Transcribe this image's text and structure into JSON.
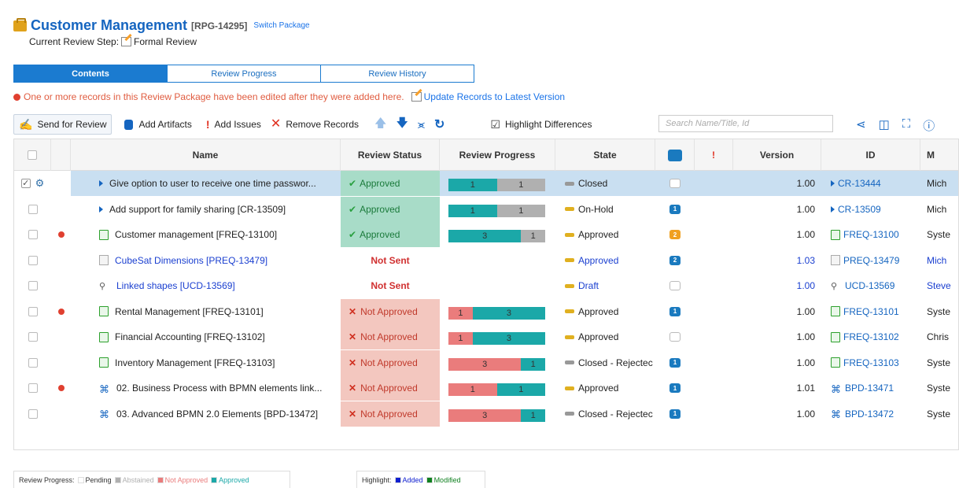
{
  "header": {
    "title": "Customer Management",
    "package_id": "[RPG-14295]",
    "switch_label": "Switch Package",
    "step_label": "Current Review Step:",
    "step_value": "Formal Review"
  },
  "tabs": [
    {
      "label": "Contents",
      "active": true
    },
    {
      "label": "Review Progress",
      "active": false
    },
    {
      "label": "Review History",
      "active": false
    }
  ],
  "warning": {
    "text": "One or more records in this Review Package have been edited after they were added here.",
    "link": "Update Records to Latest Version"
  },
  "toolbar": {
    "send": "Send for Review",
    "add_artifacts": "Add Artifacts",
    "add_issues": "Add Issues",
    "remove": "Remove Records",
    "highlight": "Highlight Differences",
    "search_placeholder": "Search Name/Title, Id"
  },
  "columns": {
    "name": "Name",
    "review_status": "Review Status",
    "review_progress": "Review Progress",
    "state": "State",
    "version": "Version",
    "id": "ID",
    "m": "M"
  },
  "rows": [
    {
      "name": "Give option to user to receive one time passwor...",
      "type": "cr",
      "status": "Approved",
      "st": "approved",
      "progress": [
        1,
        1
      ],
      "pkind": "approved-abstained",
      "state": "Closed",
      "state_color": "#999999",
      "comments": "",
      "comment_color": "",
      "version": "1.00",
      "id": "CR-13444",
      "owner": "Mich",
      "edited": false,
      "added": false,
      "selected": true
    },
    {
      "name": "Add support for family sharing [CR-13509]",
      "type": "cr",
      "status": "Approved",
      "st": "approved",
      "progress": [
        1,
        1
      ],
      "pkind": "approved-abstained",
      "state": "On-Hold",
      "state_color": "#e0b020",
      "comments": "1",
      "comment_color": "#1a7abf",
      "version": "1.00",
      "id": "CR-13509",
      "owner": "Mich",
      "edited": false,
      "added": false
    },
    {
      "name": "Customer management [FREQ-13100]",
      "type": "freq",
      "status": "Approved",
      "st": "approved",
      "progress": [
        3,
        1
      ],
      "pkind": "approved-abstained",
      "state": "Approved",
      "state_color": "#e0b020",
      "comments": "2",
      "comment_color": "#f0a020",
      "version": "1.00",
      "id": "FREQ-13100",
      "owner": "Syste",
      "edited": true,
      "added": false
    },
    {
      "name": "CubeSat Dimensions [PREQ-13479]",
      "type": "preq",
      "status": "Not Sent",
      "st": "notsent",
      "progress": [],
      "pkind": "",
      "state": "Approved",
      "state_color": "#e0b020",
      "comments": "2",
      "comment_color": "#1a7abf",
      "version": "1.03",
      "id": "PREQ-13479",
      "owner": "Mich",
      "edited": false,
      "added": true
    },
    {
      "name": "Linked shapes [UCD-13569]",
      "type": "ucd",
      "status": "Not Sent",
      "st": "notsent",
      "progress": [],
      "pkind": "",
      "state": "Draft",
      "state_color": "#e0b020",
      "comments": "",
      "comment_color": "",
      "version": "1.00",
      "id": "UCD-13569",
      "owner": "Steve",
      "edited": false,
      "added": true
    },
    {
      "name": "Rental Management [FREQ-13101]",
      "type": "freq",
      "status": "Not Approved",
      "st": "notapp",
      "progress": [
        1,
        3
      ],
      "pkind": "notapp-approved",
      "state": "Approved",
      "state_color": "#e0b020",
      "comments": "1",
      "comment_color": "#1a7abf",
      "version": "1.00",
      "id": "FREQ-13101",
      "owner": "Syste",
      "edited": true,
      "added": false
    },
    {
      "name": "Financial Accounting [FREQ-13102]",
      "type": "freq",
      "status": "Not Approved",
      "st": "notapp",
      "progress": [
        1,
        3
      ],
      "pkind": "notapp-approved",
      "state": "Approved",
      "state_color": "#e0b020",
      "comments": "",
      "comment_color": "",
      "version": "1.00",
      "id": "FREQ-13102",
      "owner": "Chris",
      "edited": false,
      "added": false
    },
    {
      "name": "Inventory Management [FREQ-13103]",
      "type": "freq",
      "status": "Not Approved",
      "st": "notapp",
      "progress": [
        3,
        1
      ],
      "pkind": "notapp-approved",
      "state": "Closed - Rejectec",
      "state_color": "#999999",
      "comments": "1",
      "comment_color": "#1a7abf",
      "version": "1.00",
      "id": "FREQ-13103",
      "owner": "Syste",
      "edited": false,
      "added": false
    },
    {
      "name": "02. Business Process with BPMN elements link...",
      "type": "bpd",
      "status": "Not Approved",
      "st": "notapp",
      "progress": [
        1,
        1
      ],
      "pkind": "notapp-approved",
      "state": "Approved",
      "state_color": "#e0b020",
      "comments": "1",
      "comment_color": "#1a7abf",
      "version": "1.01",
      "id": "BPD-13471",
      "owner": "Syste",
      "edited": true,
      "added": false
    },
    {
      "name": "03. Advanced BPMN 2.0 Elements [BPD-13472]",
      "type": "bpd",
      "status": "Not Approved",
      "st": "notapp",
      "progress": [
        3,
        1
      ],
      "pkind": "notapp-approved",
      "state": "Closed - Rejectec",
      "state_color": "#999999",
      "comments": "1",
      "comment_color": "#1a7abf",
      "version": "1.00",
      "id": "BPD-13472",
      "owner": "Syste",
      "edited": false,
      "added": false
    }
  ],
  "legend_progress": {
    "label": "Review Progress:",
    "items": [
      {
        "label": "Pending",
        "color": "#ffffff"
      },
      {
        "label": "Abstained",
        "color": "#b0b0b0"
      },
      {
        "label": "Not Approved",
        "color": "#ea7c7c"
      },
      {
        "label": "Approved",
        "color": "#1ba8a8"
      }
    ]
  },
  "legend_highlight": {
    "label": "Highlight:",
    "items": [
      {
        "label": "Added",
        "color": "#1020d0"
      },
      {
        "label": "Modified",
        "color": "#108020"
      }
    ]
  },
  "colors": {
    "approved_bar": "#1ba8a8",
    "abstained_bar": "#b0b0b0",
    "notapp_bar": "#ea7c7c",
    "accent": "#1565c0"
  }
}
